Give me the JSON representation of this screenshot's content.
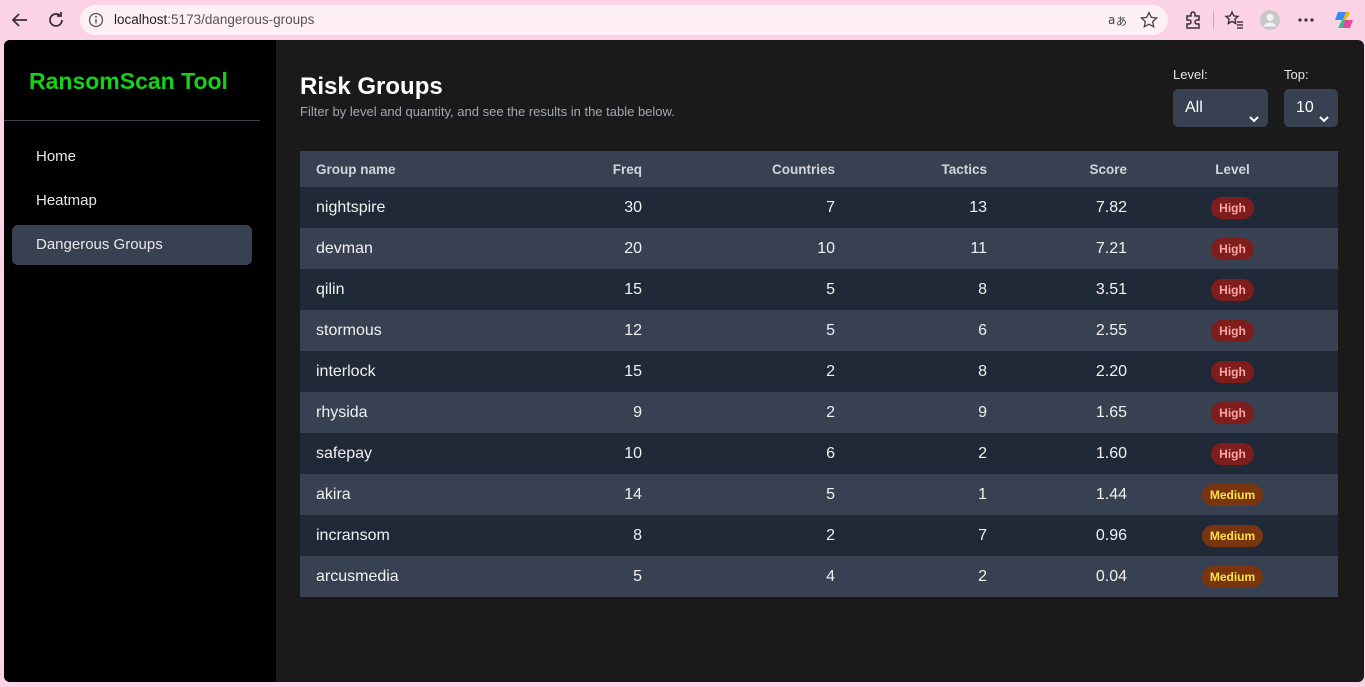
{
  "browser": {
    "url_host": "localhost",
    "url_path": ":5173/dangerous-groups"
  },
  "sidebar": {
    "brand": "RansomScan Tool",
    "brand_color": "#16d116",
    "items": [
      {
        "label": "Home",
        "active": false
      },
      {
        "label": "Heatmap",
        "active": false
      },
      {
        "label": "Dangerous Groups",
        "active": true
      }
    ]
  },
  "header": {
    "title": "Risk Groups",
    "subtitle": "Filter by level and quantity, and see the results in the table below."
  },
  "filters": {
    "level_label": "Level:",
    "level_value": "All",
    "top_label": "Top:",
    "top_value": "10"
  },
  "table": {
    "columns": [
      "Group name",
      "Freq",
      "Countries",
      "Tactics",
      "Score",
      "Level"
    ],
    "rows": [
      {
        "name": "nightspire",
        "freq": "30",
        "countries": "7",
        "tactics": "13",
        "score": "7.82",
        "level": "High"
      },
      {
        "name": "devman",
        "freq": "20",
        "countries": "10",
        "tactics": "11",
        "score": "7.21",
        "level": "High"
      },
      {
        "name": "qilin",
        "freq": "15",
        "countries": "5",
        "tactics": "8",
        "score": "3.51",
        "level": "High"
      },
      {
        "name": "stormous",
        "freq": "12",
        "countries": "5",
        "tactics": "6",
        "score": "2.55",
        "level": "High"
      },
      {
        "name": "interlock",
        "freq": "15",
        "countries": "2",
        "tactics": "8",
        "score": "2.20",
        "level": "High"
      },
      {
        "name": "rhysida",
        "freq": "9",
        "countries": "2",
        "tactics": "9",
        "score": "1.65",
        "level": "High"
      },
      {
        "name": "safepay",
        "freq": "10",
        "countries": "6",
        "tactics": "2",
        "score": "1.60",
        "level": "High"
      },
      {
        "name": "akira",
        "freq": "14",
        "countries": "5",
        "tactics": "1",
        "score": "1.44",
        "level": "Medium"
      },
      {
        "name": "incransom",
        "freq": "8",
        "countries": "2",
        "tactics": "7",
        "score": "0.96",
        "level": "Medium"
      },
      {
        "name": "arcusmedia",
        "freq": "5",
        "countries": "4",
        "tactics": "2",
        "score": "0.04",
        "level": "Medium"
      }
    ]
  }
}
